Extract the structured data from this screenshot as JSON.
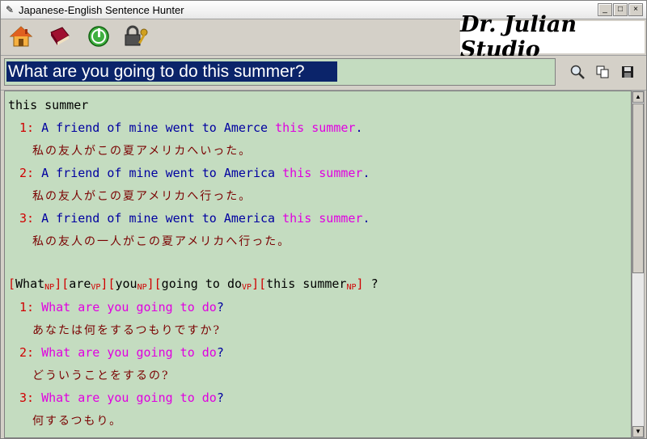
{
  "window": {
    "title": "Japanese-English Sentence Hunter",
    "buttons": [
      "_",
      "□",
      "×"
    ]
  },
  "toolbar": {
    "icons": [
      "home-icon",
      "book-icon",
      "power-icon",
      "lock-key-icon"
    ],
    "brand": "Dr. Julian Studio"
  },
  "search": {
    "value": "What are you going to do this summer?",
    "actions": [
      "magnifier-icon",
      "copy-icon",
      "save-icon"
    ]
  },
  "results": {
    "group1": {
      "heading": "this summer",
      "entries": [
        {
          "num": "1:",
          "en_pre": "A friend of mine went to Amerce",
          "en_hl": "this summer",
          "en_post": ".",
          "ja": "私の友人がこの夏アメリカへいった。"
        },
        {
          "num": "2:",
          "en_pre": "A friend of mine went to America",
          "en_hl": "this summer",
          "en_post": ".",
          "ja": "私の友人がこの夏アメリカへ行った。"
        },
        {
          "num": "3:",
          "en_pre": "A friend of mine went to America",
          "en_hl": "this summer",
          "en_post": ".",
          "ja": "私の友人の一人がこの夏アメリカへ行った。"
        }
      ]
    },
    "parse": {
      "segments": [
        {
          "word": "What",
          "tag": "NP"
        },
        {
          "word": "are",
          "tag": "VP"
        },
        {
          "word": "you",
          "tag": "NP"
        },
        {
          "word": "going to do",
          "tag": "VP"
        },
        {
          "word": "this summer",
          "tag": "NP"
        }
      ],
      "end": "?"
    },
    "group2": {
      "entries": [
        {
          "num": "1:",
          "en_hl": "What are you going to do",
          "en_post": "?",
          "ja": "あなたは何をするつもりですか?"
        },
        {
          "num": "2:",
          "en_hl": "What are you going to do",
          "en_post": "?",
          "ja": "どういうことをするの?"
        },
        {
          "num": "3:",
          "en_hl": "What are you going to do",
          "en_post": "?",
          "ja": "何するつもり。"
        }
      ]
    }
  },
  "colors": {
    "content_bg": "#c4dcc0",
    "number": "#d00000",
    "english": "#0000a0",
    "highlight": "#e000e0",
    "japanese": "#7a0000",
    "selection": "#0b246a"
  }
}
